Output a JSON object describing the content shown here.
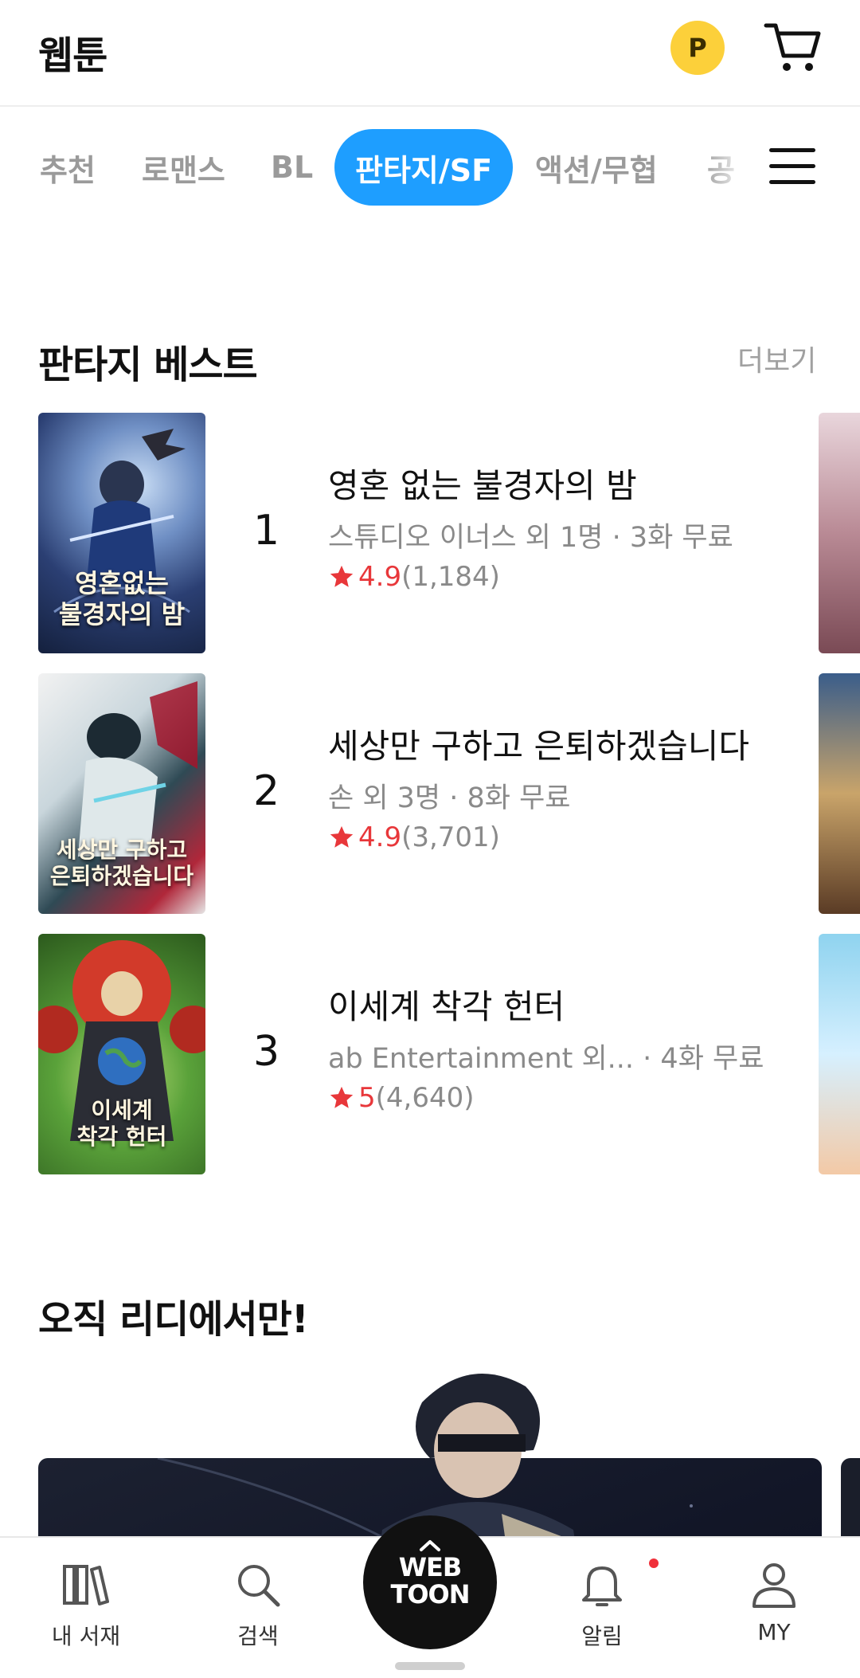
{
  "header": {
    "title": "웹툰",
    "point_badge": "P",
    "cart_icon": "cart-icon"
  },
  "tabs": [
    {
      "label": "추천",
      "active": false
    },
    {
      "label": "로맨스",
      "active": false
    },
    {
      "label": "BL",
      "active": false
    },
    {
      "label": "판타지/SF",
      "active": true
    },
    {
      "label": "액션/무협",
      "active": false
    },
    {
      "label": "공",
      "active": false
    }
  ],
  "menu_icon": "hamburger-menu-icon",
  "fantasy_best": {
    "title": "판타지 베스트",
    "more": "더보기",
    "items": [
      {
        "rank": "1",
        "title": "영혼 없는 불경자의 밤",
        "meta": "스튜디오 이너스 외 1명 · 3화 무료",
        "score": "4.9",
        "count": "(1,184)",
        "cover_text": "영혼없는\n불경자의 밤"
      },
      {
        "rank": "2",
        "title": "세상만 구하고 은퇴하겠습니다",
        "meta": "손 외 3명 · 8화 무료",
        "score": "4.9",
        "count": "(3,701)",
        "cover_text": "세상만 구하고\n은퇴하겠습니다"
      },
      {
        "rank": "3",
        "title": "이세계 착각 헌터",
        "meta": "ab Entertainment 외... · 4화 무료",
        "score": "5",
        "count": "(4,640)",
        "cover_text": "이세계\n착각 헌터"
      }
    ]
  },
  "ridi_only": {
    "title": "오직 리디에서만!"
  },
  "bottom_nav": {
    "library": "내 서재",
    "search": "검색",
    "webtoon_line1": "WEB",
    "webtoon_line2": "TOON",
    "notifications": "알림",
    "my": "MY"
  },
  "colors": {
    "accent_blue": "#1e9eff",
    "point_yellow": "#fcd03a",
    "rating_red": "#e8373a"
  }
}
